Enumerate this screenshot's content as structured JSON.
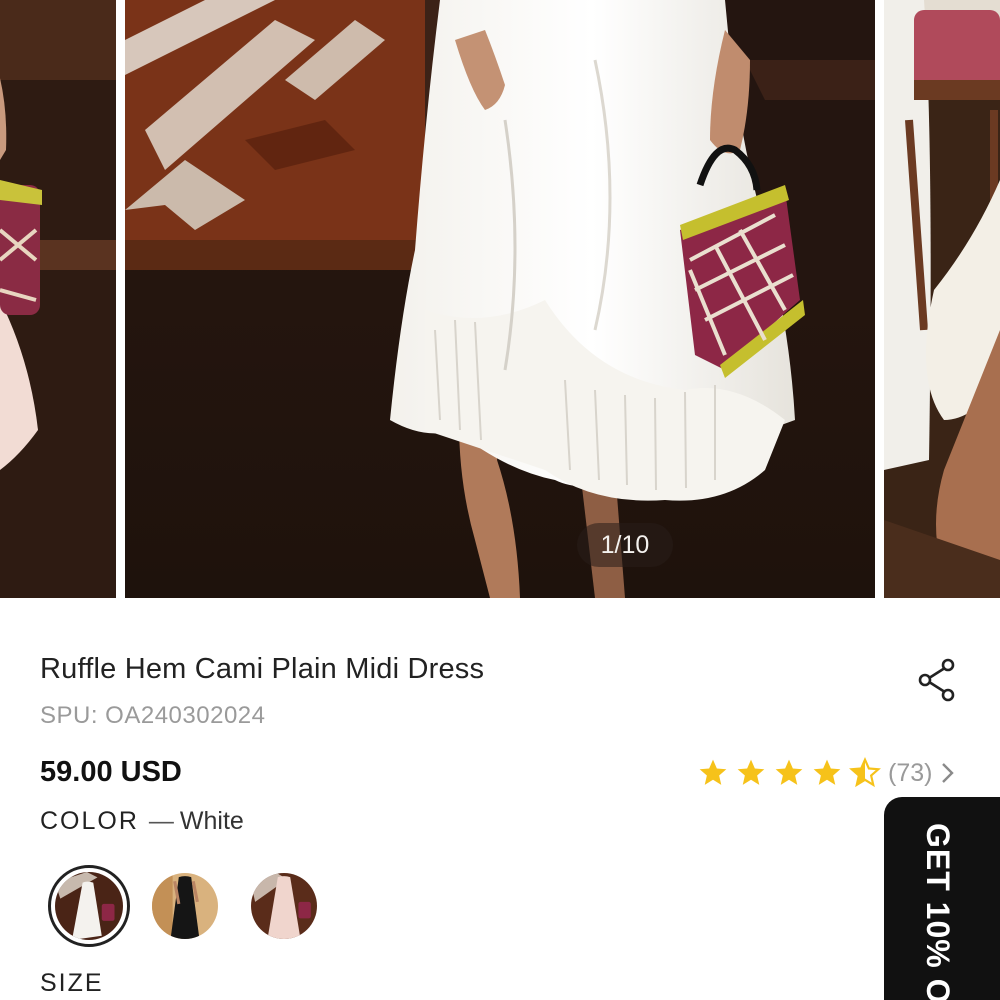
{
  "carousel": {
    "counter": "1/10",
    "slides": [
      {
        "name": "slide-previous",
        "color": "pink"
      },
      {
        "name": "slide-current",
        "color": "white"
      },
      {
        "name": "slide-next",
        "color": "white"
      }
    ]
  },
  "product": {
    "title": "Ruffle Hem Cami Plain Midi Dress",
    "spu": "SPU: OA240302024",
    "price": "59.00 USD",
    "rating": {
      "stars": 4.5,
      "max": 5,
      "review_count": "(73)"
    },
    "color_label": "COLOR",
    "color_dash": "—",
    "color_value": "White",
    "swatches": [
      {
        "name": "White",
        "selected": true
      },
      {
        "name": "Black",
        "selected": false
      },
      {
        "name": "Pink",
        "selected": false
      }
    ],
    "size_label": "SIZE"
  },
  "promo": {
    "label": "GET 10% O"
  },
  "icons": {
    "share": "share-icon",
    "star": "star-icon",
    "chevron": "chevron-right-icon"
  },
  "colors": {
    "star": "#F6C21A",
    "text": "#222222",
    "muted": "#9A9A9A",
    "promo_bg": "#111111"
  }
}
